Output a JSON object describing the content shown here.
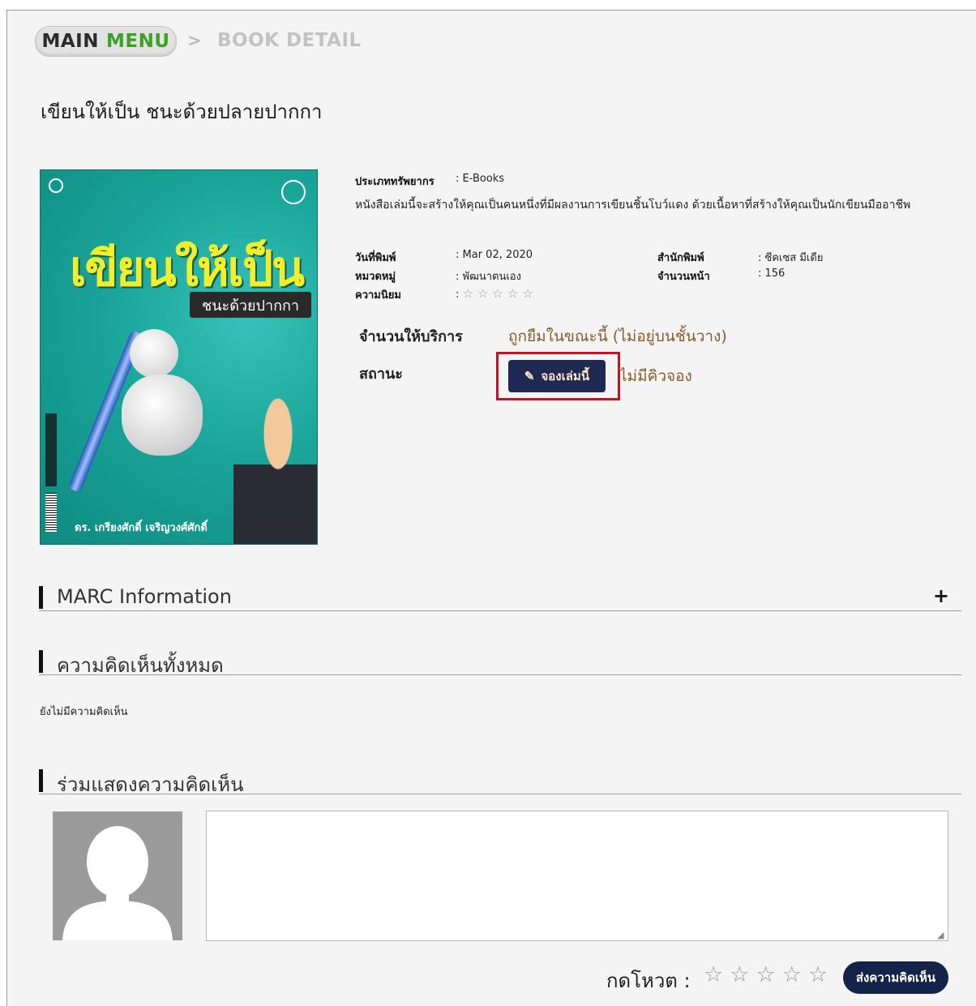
{
  "breadcrumb": {
    "main": "MAIN",
    "menu": "MENU",
    "separator": ">",
    "current": "BOOK DETAIL"
  },
  "book": {
    "title": "เขียนให้เป็น ชนะด้วยปลายปากกา",
    "cover": {
      "big_title": "เขียนให้เป็น",
      "subtitle": "ชนะด้วยปากกา",
      "author_line": "ดร. เกรียงศักดิ์ เจริญวงศ์ศักดิ์"
    },
    "resource_type_label": "ประเภททรัพยากร",
    "resource_type_value": ": E-Books",
    "description": "หนังสือเล่มนี้จะสร้างให้คุณเป็นคนหนึ่งที่มีผลงานการเขียนชิ้นโบว์แดง ด้วยเนื้อหาที่สร้างให้คุณเป็นนักเขียนมืออาชีพ",
    "publish_date_label": "วันที่พิมพ์",
    "publish_date_value": ": Mar 02, 2020",
    "publisher_label": "สำนักพิมพ์",
    "publisher_value": ": ซีคเซส มีเดีย",
    "category_label": "หมวดหมู่",
    "category_value": ": พัฒนาตนเอง",
    "pages_label": "จำนวนหน้า",
    "pages_value": ": 156",
    "popularity_label": "ความนิยม",
    "popularity_prefix": ":",
    "popularity_stars": "☆☆☆☆☆",
    "popularity_rating": 0
  },
  "availability": {
    "service_label": "จำนวนให้บริการ",
    "service_value": "ถูกยืมในขณะนี้ (ไม่อยู่บนชั้นวาง)",
    "status_label": "สถานะ",
    "reserve_button": "จองเล่มนี้",
    "queue_text": "ไม่มีคิวจอง"
  },
  "sections": {
    "marc": "MARC Information",
    "marc_toggle": "+",
    "all_comments": "ความคิดเห็นทั้งหมด",
    "no_comments": "ยังไม่มีความคิดเห็น",
    "add_comment": "ร่วมแสดงความคิดเห็น"
  },
  "comment_form": {
    "textarea_value": "",
    "vote_label": "กดโหวต :",
    "vote_star": "☆",
    "vote_rating": 0,
    "submit_button": "ส่งความคิดเห็น"
  },
  "colors": {
    "menu_green": "#3aa327",
    "reserve_button_bg": "#1e2a52",
    "highlight_border": "#c0121f",
    "status_text": "#8a5a2a",
    "submit_button_bg": "#15234a"
  }
}
